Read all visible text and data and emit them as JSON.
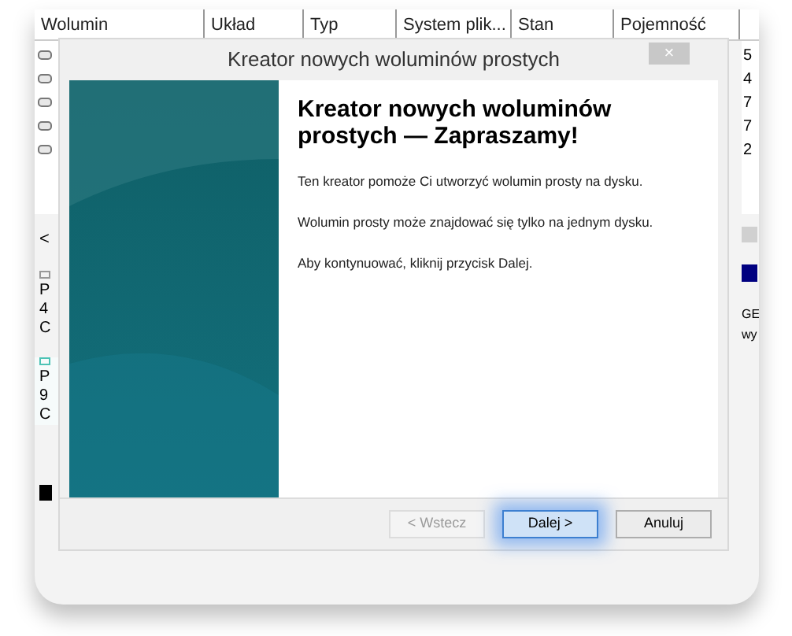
{
  "background_window": {
    "columns": [
      "Wolumin",
      "Układ",
      "Typ",
      "System plik...",
      "Stan",
      "Pojemność"
    ],
    "rows": [
      {
        "column_7": "5"
      },
      {
        "column_7": "4"
      },
      {
        "column_7": "7"
      },
      {
        "column_7": "7"
      },
      {
        "column_7": "2"
      }
    ],
    "scroll_left": "<",
    "disks": [
      {
        "lines": [
          "P",
          "4",
          "C"
        ],
        "selected": false
      },
      {
        "lines": [
          "P",
          "9",
          "C"
        ],
        "selected": true
      }
    ],
    "right_panel": [
      "GE",
      "wy"
    ]
  },
  "dialog": {
    "title": "Kreator nowych woluminów prostych",
    "close": "×",
    "heading": "Kreator nowych woluminów prostych — Zapraszamy!",
    "paragraphs": [
      "Ten kreator pomoże Ci utworzyć wolumin prosty na dysku.",
      "Wolumin prosty może znajdować się tylko na jednym dysku.",
      "Aby kontynuować, kliknij przycisk Dalej."
    ],
    "buttons": [
      {
        "label": "< Wstecz",
        "disabled": true,
        "selected": false
      },
      {
        "label": "Dalej >",
        "disabled": false,
        "selected": true
      },
      {
        "label": "Anuluj",
        "disabled": false,
        "selected": false
      }
    ]
  }
}
